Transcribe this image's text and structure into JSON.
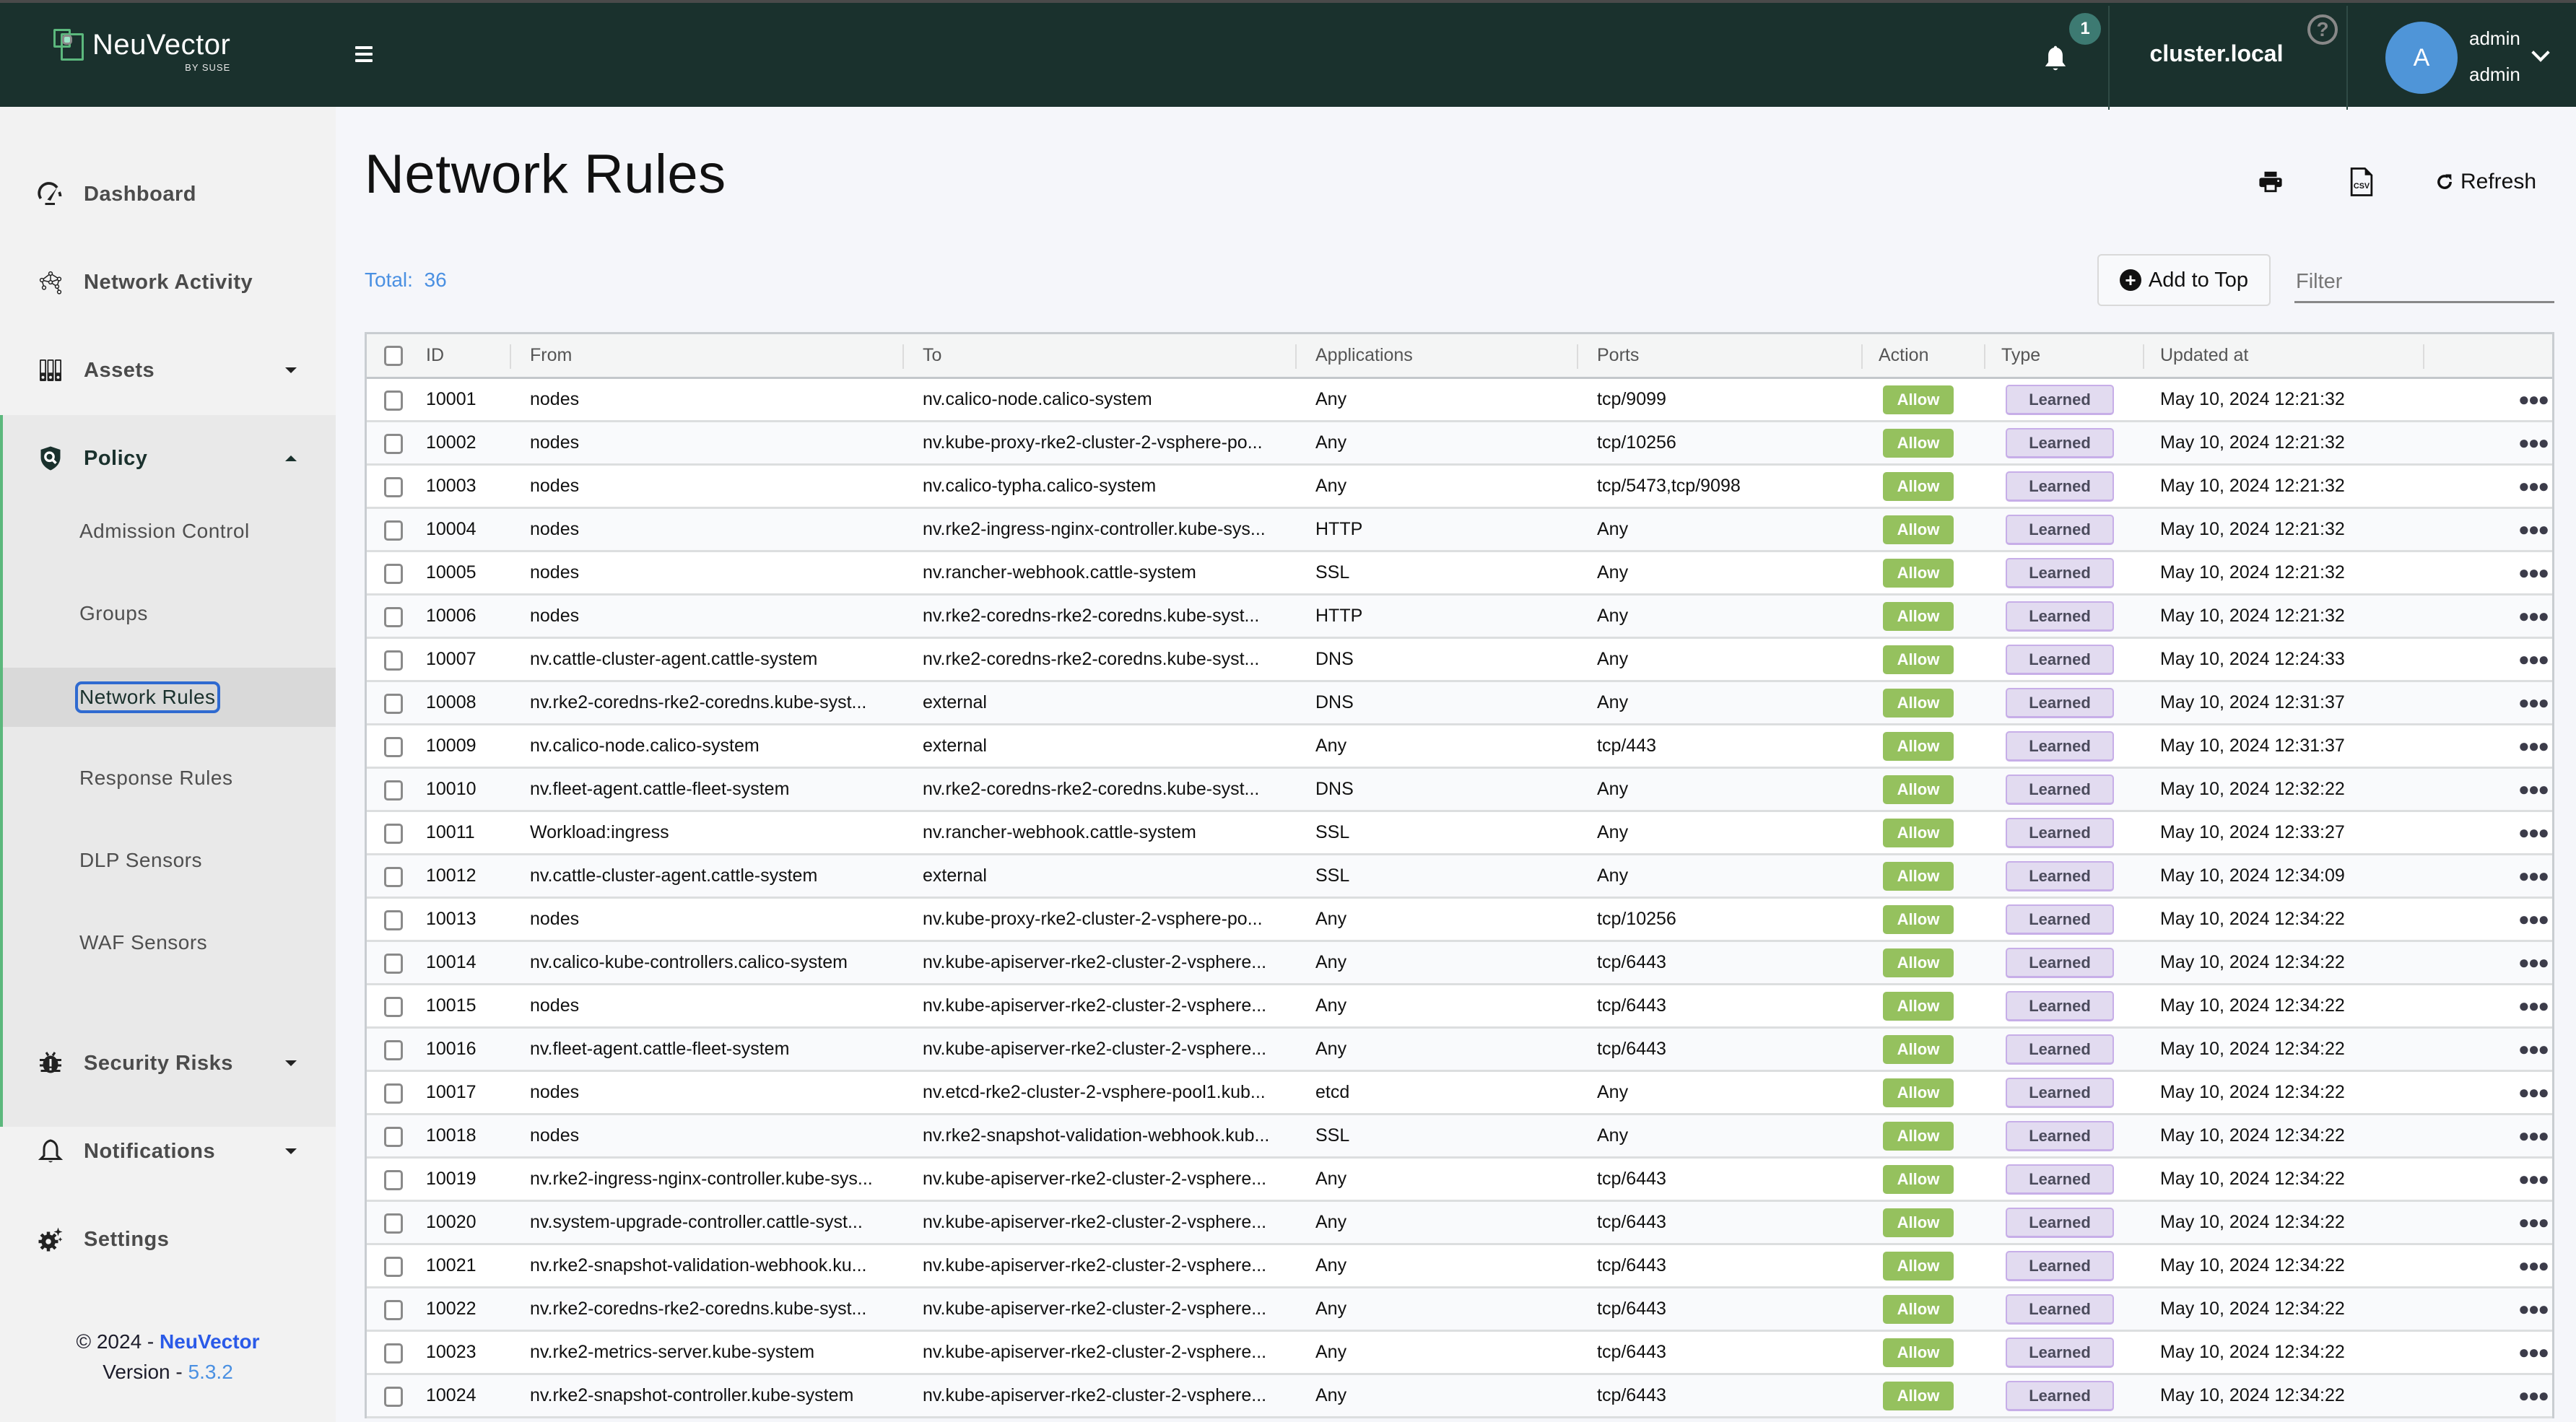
{
  "header": {
    "logo_name": "NeuVector",
    "logo_sub": "BY SUSE",
    "notification_count": "1",
    "cluster": "cluster.local",
    "help_icon": "?",
    "avatar_initial": "A",
    "user_name": "admin",
    "user_role": "admin"
  },
  "sidebar": {
    "items": [
      {
        "label": "Dashboard",
        "icon": "speedometer-icon"
      },
      {
        "label": "Network Activity",
        "icon": "network-graph-icon"
      },
      {
        "label": "Assets",
        "icon": "binders-icon"
      },
      {
        "label": "Policy",
        "icon": "shield-search-icon"
      },
      {
        "label": "Security Risks",
        "icon": "bug-icon"
      },
      {
        "label": "Notifications",
        "icon": "bell-icon"
      },
      {
        "label": "Settings",
        "icon": "gear-icon"
      }
    ],
    "policy_sub": [
      {
        "label": "Admission Control"
      },
      {
        "label": "Groups"
      },
      {
        "label": "Network Rules"
      },
      {
        "label": "Response Rules"
      },
      {
        "label": "DLP Sensors"
      },
      {
        "label": "WAF Sensors"
      }
    ],
    "footer": {
      "copyright": "© 2024 - ",
      "brand": "NeuVector",
      "version_label": "Version - ",
      "version": "5.3.2"
    }
  },
  "main": {
    "title": "Network Rules",
    "total_label": "Total:",
    "total_value": "36",
    "toolbar": {
      "print_icon": "print-icon",
      "csv_icon": "csv-icon",
      "refresh_label": "Refresh"
    },
    "add_to_top_label": "Add to Top",
    "filter_placeholder": "Filter",
    "filter_value": ""
  },
  "table": {
    "columns": [
      "ID",
      "From",
      "To",
      "Applications",
      "Ports",
      "Action",
      "Type",
      "Updated at"
    ],
    "rows": [
      {
        "id": "10001",
        "from": "nodes",
        "to": "nv.calico-node.calico-system",
        "app": "Any",
        "ports": "tcp/9099",
        "action": "Allow",
        "type": "Learned",
        "updated": "May 10, 2024 12:21:32"
      },
      {
        "id": "10002",
        "from": "nodes",
        "to": "nv.kube-proxy-rke2-cluster-2-vsphere-po...",
        "app": "Any",
        "ports": "tcp/10256",
        "action": "Allow",
        "type": "Learned",
        "updated": "May 10, 2024 12:21:32"
      },
      {
        "id": "10003",
        "from": "nodes",
        "to": "nv.calico-typha.calico-system",
        "app": "Any",
        "ports": "tcp/5473,tcp/9098",
        "action": "Allow",
        "type": "Learned",
        "updated": "May 10, 2024 12:21:32"
      },
      {
        "id": "10004",
        "from": "nodes",
        "to": "nv.rke2-ingress-nginx-controller.kube-sys...",
        "app": "HTTP",
        "ports": "Any",
        "action": "Allow",
        "type": "Learned",
        "updated": "May 10, 2024 12:21:32"
      },
      {
        "id": "10005",
        "from": "nodes",
        "to": "nv.rancher-webhook.cattle-system",
        "app": "SSL",
        "ports": "Any",
        "action": "Allow",
        "type": "Learned",
        "updated": "May 10, 2024 12:21:32"
      },
      {
        "id": "10006",
        "from": "nodes",
        "to": "nv.rke2-coredns-rke2-coredns.kube-syst...",
        "app": "HTTP",
        "ports": "Any",
        "action": "Allow",
        "type": "Learned",
        "updated": "May 10, 2024 12:21:32"
      },
      {
        "id": "10007",
        "from": "nv.cattle-cluster-agent.cattle-system",
        "to": "nv.rke2-coredns-rke2-coredns.kube-syst...",
        "app": "DNS",
        "ports": "Any",
        "action": "Allow",
        "type": "Learned",
        "updated": "May 10, 2024 12:24:33"
      },
      {
        "id": "10008",
        "from": "nv.rke2-coredns-rke2-coredns.kube-syst...",
        "to": "external",
        "app": "DNS",
        "ports": "Any",
        "action": "Allow",
        "type": "Learned",
        "updated": "May 10, 2024 12:31:37"
      },
      {
        "id": "10009",
        "from": "nv.calico-node.calico-system",
        "to": "external",
        "app": "Any",
        "ports": "tcp/443",
        "action": "Allow",
        "type": "Learned",
        "updated": "May 10, 2024 12:31:37"
      },
      {
        "id": "10010",
        "from": "nv.fleet-agent.cattle-fleet-system",
        "to": "nv.rke2-coredns-rke2-coredns.kube-syst...",
        "app": "DNS",
        "ports": "Any",
        "action": "Allow",
        "type": "Learned",
        "updated": "May 10, 2024 12:32:22"
      },
      {
        "id": "10011",
        "from": "Workload:ingress",
        "to": "nv.rancher-webhook.cattle-system",
        "app": "SSL",
        "ports": "Any",
        "action": "Allow",
        "type": "Learned",
        "updated": "May 10, 2024 12:33:27"
      },
      {
        "id": "10012",
        "from": "nv.cattle-cluster-agent.cattle-system",
        "to": "external",
        "app": "SSL",
        "ports": "Any",
        "action": "Allow",
        "type": "Learned",
        "updated": "May 10, 2024 12:34:09"
      },
      {
        "id": "10013",
        "from": "nodes",
        "to": "nv.kube-proxy-rke2-cluster-2-vsphere-po...",
        "app": "Any",
        "ports": "tcp/10256",
        "action": "Allow",
        "type": "Learned",
        "updated": "May 10, 2024 12:34:22"
      },
      {
        "id": "10014",
        "from": "nv.calico-kube-controllers.calico-system",
        "to": "nv.kube-apiserver-rke2-cluster-2-vsphere...",
        "app": "Any",
        "ports": "tcp/6443",
        "action": "Allow",
        "type": "Learned",
        "updated": "May 10, 2024 12:34:22"
      },
      {
        "id": "10015",
        "from": "nodes",
        "to": "nv.kube-apiserver-rke2-cluster-2-vsphere...",
        "app": "Any",
        "ports": "tcp/6443",
        "action": "Allow",
        "type": "Learned",
        "updated": "May 10, 2024 12:34:22"
      },
      {
        "id": "10016",
        "from": "nv.fleet-agent.cattle-fleet-system",
        "to": "nv.kube-apiserver-rke2-cluster-2-vsphere...",
        "app": "Any",
        "ports": "tcp/6443",
        "action": "Allow",
        "type": "Learned",
        "updated": "May 10, 2024 12:34:22"
      },
      {
        "id": "10017",
        "from": "nodes",
        "to": "nv.etcd-rke2-cluster-2-vsphere-pool1.kub...",
        "app": "etcd",
        "ports": "Any",
        "action": "Allow",
        "type": "Learned",
        "updated": "May 10, 2024 12:34:22"
      },
      {
        "id": "10018",
        "from": "nodes",
        "to": "nv.rke2-snapshot-validation-webhook.kub...",
        "app": "SSL",
        "ports": "Any",
        "action": "Allow",
        "type": "Learned",
        "updated": "May 10, 2024 12:34:22"
      },
      {
        "id": "10019",
        "from": "nv.rke2-ingress-nginx-controller.kube-sys...",
        "to": "nv.kube-apiserver-rke2-cluster-2-vsphere...",
        "app": "Any",
        "ports": "tcp/6443",
        "action": "Allow",
        "type": "Learned",
        "updated": "May 10, 2024 12:34:22"
      },
      {
        "id": "10020",
        "from": "nv.system-upgrade-controller.cattle-syst...",
        "to": "nv.kube-apiserver-rke2-cluster-2-vsphere...",
        "app": "Any",
        "ports": "tcp/6443",
        "action": "Allow",
        "type": "Learned",
        "updated": "May 10, 2024 12:34:22"
      },
      {
        "id": "10021",
        "from": "nv.rke2-snapshot-validation-webhook.ku...",
        "to": "nv.kube-apiserver-rke2-cluster-2-vsphere...",
        "app": "Any",
        "ports": "tcp/6443",
        "action": "Allow",
        "type": "Learned",
        "updated": "May 10, 2024 12:34:22"
      },
      {
        "id": "10022",
        "from": "nv.rke2-coredns-rke2-coredns.kube-syst...",
        "to": "nv.kube-apiserver-rke2-cluster-2-vsphere...",
        "app": "Any",
        "ports": "tcp/6443",
        "action": "Allow",
        "type": "Learned",
        "updated": "May 10, 2024 12:34:22"
      },
      {
        "id": "10023",
        "from": "nv.rke2-metrics-server.kube-system",
        "to": "nv.kube-apiserver-rke2-cluster-2-vsphere...",
        "app": "Any",
        "ports": "tcp/6443",
        "action": "Allow",
        "type": "Learned",
        "updated": "May 10, 2024 12:34:22"
      },
      {
        "id": "10024",
        "from": "nv.rke2-snapshot-controller.kube-system",
        "to": "nv.kube-apiserver-rke2-cluster-2-vsphere...",
        "app": "Any",
        "ports": "tcp/6443",
        "action": "Allow",
        "type": "Learned",
        "updated": "May 10, 2024 12:34:22"
      }
    ]
  },
  "colors": {
    "header_bg": "#1a312d",
    "accent_green": "#5cb87d",
    "allow_badge": "#95c15e",
    "learned_badge_bg": "#e2dbf0",
    "learned_badge_border": "#c7aee8",
    "link_blue": "#4a90e2",
    "avatar_blue": "#4f95d8",
    "notification_badge": "#3d7a72"
  }
}
